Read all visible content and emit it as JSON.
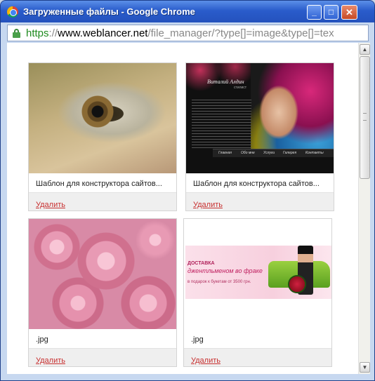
{
  "window": {
    "title": "Загруженные файлы - Google Chrome",
    "controls": {
      "minimize": "_",
      "maximize": "□",
      "close": "✕"
    }
  },
  "addressbar": {
    "scheme": "https",
    "separator": "://",
    "host": "www.weblancer.net",
    "path": "/file_manager/?type[]=image&type[]=tex"
  },
  "template_text": {
    "name": "Виталий Алдин",
    "subtitle": "стилист",
    "menu": [
      "Главная",
      "Обо мне",
      "Услуги",
      "Галерея",
      "Контакты"
    ]
  },
  "banner_text": {
    "line1": "ДОСТАВКА",
    "line2": "джентльменом во фраке",
    "line3": "в подарок к букетам от 3500 грн."
  },
  "files": [
    {
      "caption": "Шаблон для конструктора сайтов...",
      "delete_label": "Удалить",
      "image": "eye-makeup-photo"
    },
    {
      "caption": "Шаблон для конструктора сайтов...",
      "delete_label": "Удалить",
      "image": "website-template-preview"
    },
    {
      "caption": ".jpg",
      "delete_label": "Удалить",
      "image": "pink-roses-photo"
    },
    {
      "caption": ".jpg",
      "delete_label": "Удалить",
      "image": "flower-delivery-banner"
    }
  ]
}
